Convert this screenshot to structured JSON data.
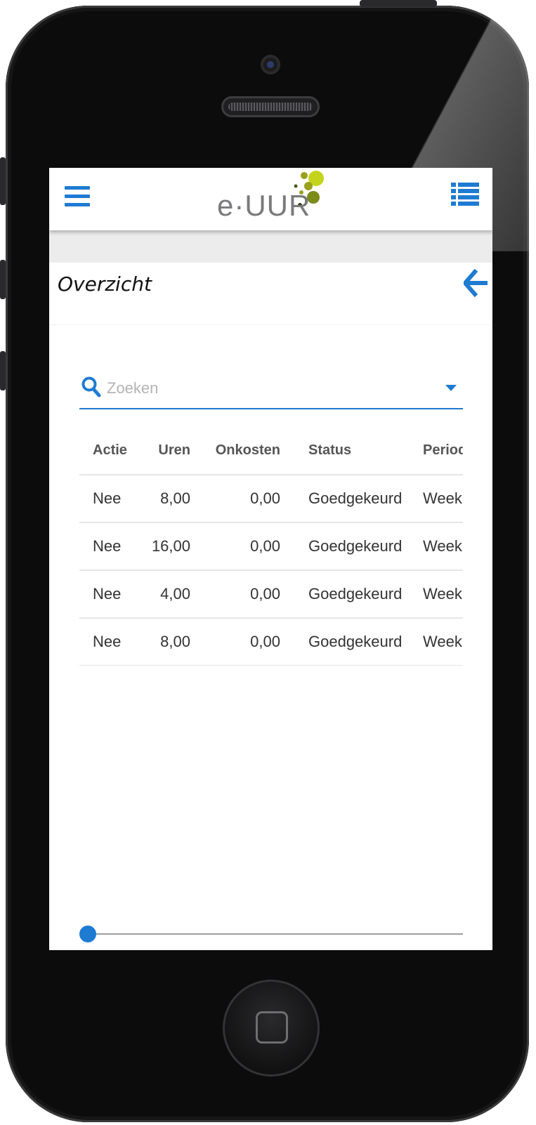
{
  "app": {
    "logo_text": "e·UUR",
    "accent_color": "#1e7bd2",
    "menu_icon": "hamburger-menu-icon",
    "list_icon": "list-view-icon"
  },
  "page": {
    "title": "Overzicht",
    "back_icon": "arrow-left-icon"
  },
  "search": {
    "placeholder": "Zoeken",
    "value": "",
    "icon": "search-icon",
    "dropdown_icon": "caret-down-icon"
  },
  "table": {
    "columns": [
      "Actie",
      "Uren",
      "Onkosten",
      "Status",
      "Period"
    ],
    "rows": [
      {
        "actie": "Nee",
        "uren": "8,00",
        "onkosten": "0,00",
        "status": "Goedgekeurd",
        "periode": "Week"
      },
      {
        "actie": "Nee",
        "uren": "16,00",
        "onkosten": "0,00",
        "status": "Goedgekeurd",
        "periode": "Week"
      },
      {
        "actie": "Nee",
        "uren": "4,00",
        "onkosten": "0,00",
        "status": "Goedgekeurd",
        "periode": "Week"
      },
      {
        "actie": "Nee",
        "uren": "8,00",
        "onkosten": "0,00",
        "status": "Goedgekeurd",
        "periode": "Week"
      }
    ]
  },
  "scroll": {
    "position_fraction": 0
  }
}
